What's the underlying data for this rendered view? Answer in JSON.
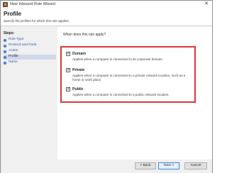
{
  "window": {
    "title": "New Inbound Rule Wizard",
    "close_glyph": "✕"
  },
  "header": {
    "title": "Profile",
    "subtitle": "Specify the profiles for which this rule applies."
  },
  "sidebar": {
    "steps_label": "Steps:",
    "items": [
      {
        "label": "Rule Type",
        "current": false
      },
      {
        "label": "Protocol and Ports",
        "current": false
      },
      {
        "label": "Action",
        "current": false
      },
      {
        "label": "Profile",
        "current": true
      },
      {
        "label": "Name",
        "current": false
      }
    ]
  },
  "main": {
    "question": "When does this rule apply?",
    "options": [
      {
        "label": "Domain",
        "checked": true,
        "description": "Applies when a computer is connected to its corporate domain."
      },
      {
        "label": "Private",
        "checked": true,
        "description": "Applies when a computer is connected to a private network location, such as a home or work place."
      },
      {
        "label": "Public",
        "checked": true,
        "description": "Applies when a computer is connected to a public network location."
      }
    ],
    "highlight_color": "#d9262b"
  },
  "footer": {
    "back_label": "< Back",
    "next_label": "Next >",
    "cancel_label": "Cancel"
  }
}
